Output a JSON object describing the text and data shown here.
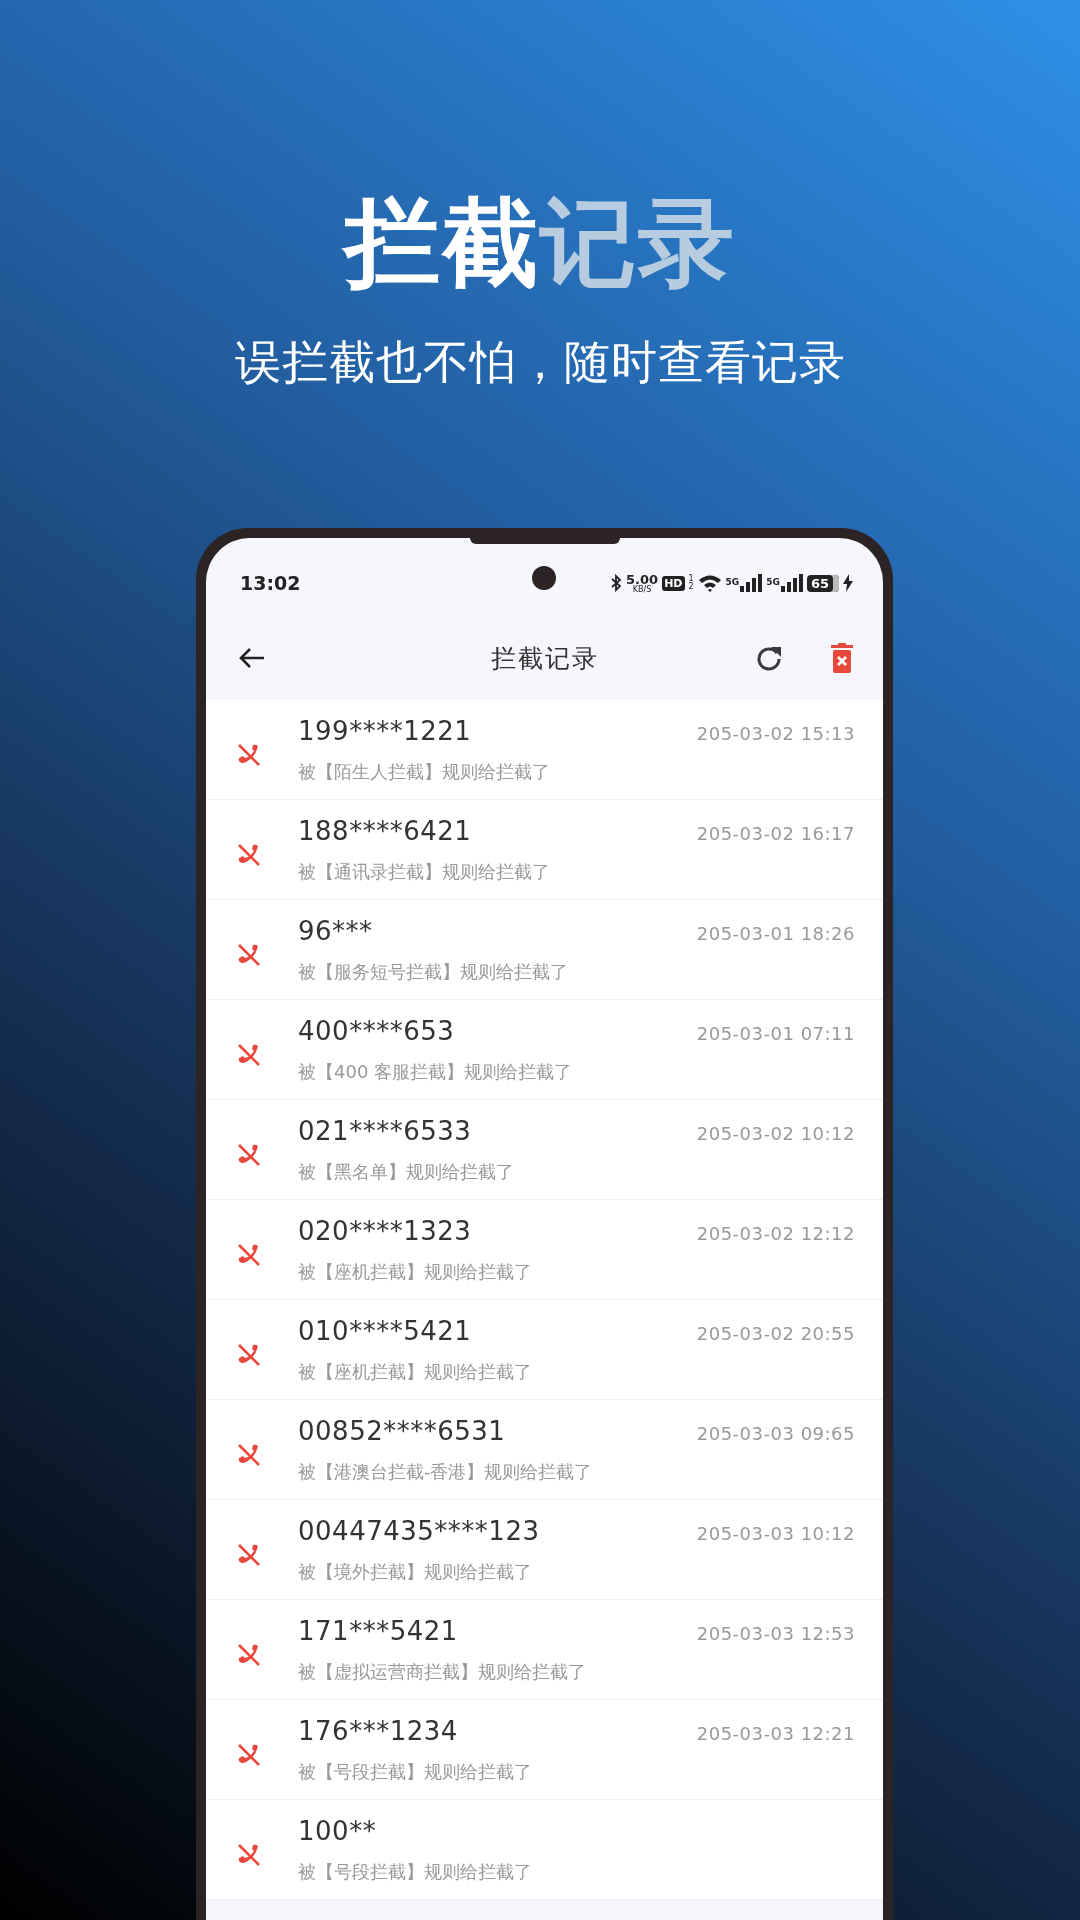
{
  "hero": {
    "title": {
      "strong": "拦截",
      "light": "记录"
    },
    "subtitle": "误拦截也不怕，随时查看记录"
  },
  "status_bar": {
    "time": "13:02",
    "speed": "5.00",
    "speed_unit": "KB/S",
    "hd": "HD",
    "sim_1": "1",
    "sim_2": "2",
    "network_1": "5G",
    "network_2": "5G",
    "battery": "65"
  },
  "app_bar": {
    "title": "拦截记录"
  },
  "records": [
    {
      "number": "199****1221",
      "time": "205-03-02 15:13",
      "reason": "被【陌生人拦截】规则给拦截了"
    },
    {
      "number": "188****6421",
      "time": "205-03-02 16:17",
      "reason": "被【通讯录拦截】规则给拦截了"
    },
    {
      "number": "96***",
      "time": "205-03-01 18:26",
      "reason": "被【服务短号拦截】规则给拦截了"
    },
    {
      "number": "400****653",
      "time": "205-03-01 07:11",
      "reason": "被【400 客服拦截】规则给拦截了"
    },
    {
      "number": "021****6533",
      "time": "205-03-02 10:12",
      "reason": "被【黑名单】规则给拦截了"
    },
    {
      "number": "020****1323",
      "time": "205-03-02 12:12",
      "reason": "被【座机拦截】规则给拦截了"
    },
    {
      "number": "010****5421",
      "time": "205-03-02 20:55",
      "reason": "被【座机拦截】规则给拦截了"
    },
    {
      "number": "00852****6531",
      "time": "205-03-03 09:65",
      "reason": "被【港澳台拦截-香港】规则给拦截了"
    },
    {
      "number": "00447435****123",
      "time": "205-03-03 10:12",
      "reason": "被【境外拦截】规则给拦截了"
    },
    {
      "number": "171***5421",
      "time": "205-03-03 12:53",
      "reason": "被【虚拟运营商拦截】规则给拦截了"
    },
    {
      "number": "176***1234",
      "time": "205-03-03 12:21",
      "reason": "被【号段拦截】规则给拦截了"
    },
    {
      "number": "100**",
      "reason": "被【号段拦截】规则给拦截了"
    }
  ]
}
